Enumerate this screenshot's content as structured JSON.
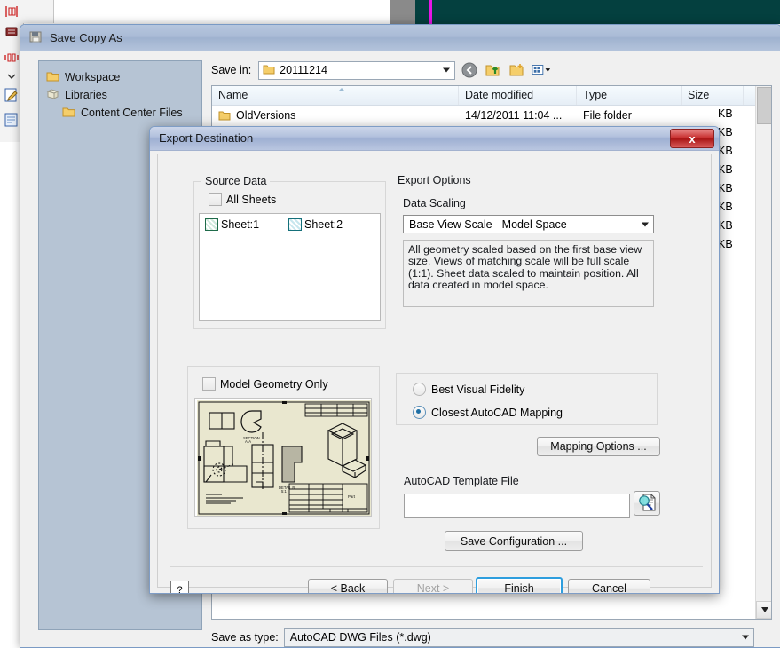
{
  "backdrop": {
    "toolbar_icons": [
      "mirror-icon",
      "flip-icon",
      "pattern-icon",
      "dropdown-icon",
      "sketch-edit-icon",
      "new-sheet-icon"
    ]
  },
  "save_window": {
    "title": "Save Copy As",
    "app_icon": "inventor-save-icon",
    "places": [
      {
        "label": "Workspace",
        "icon": "folder-icon",
        "indent": false
      },
      {
        "label": "Libraries",
        "icon": "libraries-icon",
        "indent": false
      },
      {
        "label": "Content Center Files",
        "icon": "folder-icon",
        "indent": true
      }
    ],
    "save_in": {
      "label": "Save in:",
      "value": "20111214",
      "icon": "folder-icon"
    },
    "nav_buttons": [
      {
        "name": "back-button",
        "icon": "back-arrow-icon"
      },
      {
        "name": "up-one-level-button",
        "icon": "up-folder-icon"
      },
      {
        "name": "new-folder-button",
        "icon": "new-folder-icon"
      },
      {
        "name": "views-button",
        "icon": "views-grid-icon"
      }
    ],
    "columns": [
      "Name",
      "Date modified",
      "Type",
      "Size"
    ],
    "rows": [
      {
        "name": "OldVersions",
        "date": "14/12/2011 11:04 ...",
        "type": "File folder",
        "size": "",
        "icon": "folder-icon"
      }
    ],
    "obscured_size_rows": [
      "KB",
      "KB",
      "KB",
      "KB",
      "KB",
      "KB",
      "KB",
      "KB"
    ],
    "save_as_type": {
      "label": "Save as type:",
      "value": "AutoCAD DWG Files (*.dwg)"
    }
  },
  "export_dialog": {
    "title": "Export Destination",
    "close_label": "x",
    "source_data": {
      "legend": "Source Data",
      "all_sheets_label": "All Sheets",
      "all_sheets_checked": false,
      "sheets": [
        {
          "label": "Sheet:1",
          "icon": "sheet-icon",
          "color": "#2f8f63"
        },
        {
          "label": "Sheet:2",
          "icon": "sheet-icon",
          "color": "#1b8b96"
        }
      ]
    },
    "model_geometry": {
      "legend": "",
      "label": "Model Geometry Only",
      "checked": false,
      "preview_name": "drawing-preview-thumbnail"
    },
    "export_options": {
      "legend": "Export Options",
      "data_scaling_label": "Data Scaling",
      "scale_value": "Base View Scale - Model Space",
      "description": "All geometry scaled based on the first base view size. Views of matching scale will be full scale (1:1). Sheet data scaled to maintain position. All data created in model space.",
      "fidelity_options": [
        {
          "label": "Best Visual Fidelity",
          "selected": false
        },
        {
          "label": "Closest AutoCAD Mapping",
          "selected": true
        }
      ],
      "mapping_options_label": "Mapping Options ...",
      "template_label": "AutoCAD Template File",
      "template_value": "",
      "browse_icon": "magnifier-document-icon"
    },
    "save_configuration_label": "Save Configuration ...",
    "help_label": "?",
    "buttons": {
      "back": "< Back",
      "next": "Next >",
      "next_disabled": true,
      "finish": "Finish",
      "finish_default": true,
      "cancel": "Cancel"
    }
  },
  "colors": {
    "accent_blue": "#2e9ede",
    "title_blue": "#b4c2de",
    "close_red": "#c62b2b",
    "places_bg": "#b6c4d4",
    "teal_canvas": "#04403f",
    "magenta_marker": "#e716e7",
    "preview_paper": "#e9e7cf"
  }
}
